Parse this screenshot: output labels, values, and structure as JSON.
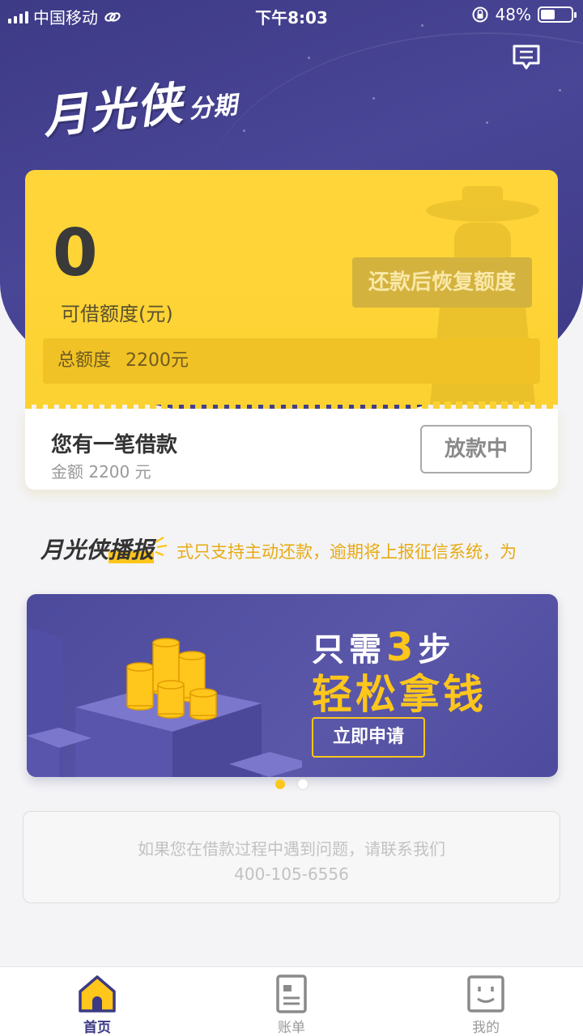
{
  "status_bar": {
    "carrier": "中国移动",
    "time": "下午8:03",
    "battery_percent": "48%",
    "battery_level": 0.48
  },
  "header": {
    "logo_main": "月光侠",
    "logo_sub": "分期",
    "message_icon": "message-icon"
  },
  "credit_card": {
    "available_amount": "0",
    "available_label": "可借额度(元)",
    "restore_button": "还款后恢复额度",
    "total_label": "总额度",
    "total_value": "2200元"
  },
  "loan": {
    "title": "您有一笔借款",
    "amount_text": "金额 2200 元",
    "status_button": "放款中"
  },
  "broadcast": {
    "logo_part1": "月光侠",
    "logo_part2": "播报",
    "ticker_text": "式只支持主动还款，逾期将上报征信系统，为"
  },
  "banner": {
    "line1_prefix": "只需",
    "line1_number": "3",
    "line1_suffix": "步",
    "line2": "轻松拿钱",
    "apply_button": "立即申请",
    "active_index": 0,
    "total_slides": 2
  },
  "contact": {
    "line1": "如果您在借款过程中遇到问题，请联系我们",
    "phone": "400-105-6556"
  },
  "tabbar": {
    "items": [
      {
        "label": "首页",
        "icon": "home-icon",
        "active": true
      },
      {
        "label": "账单",
        "icon": "bill-icon",
        "active": false
      },
      {
        "label": "我的",
        "icon": "profile-icon",
        "active": false
      }
    ]
  },
  "colors": {
    "brand_purple": "#3d3a86",
    "accent_yellow": "#ffc61b",
    "card_yellow": "#ffd53a"
  }
}
